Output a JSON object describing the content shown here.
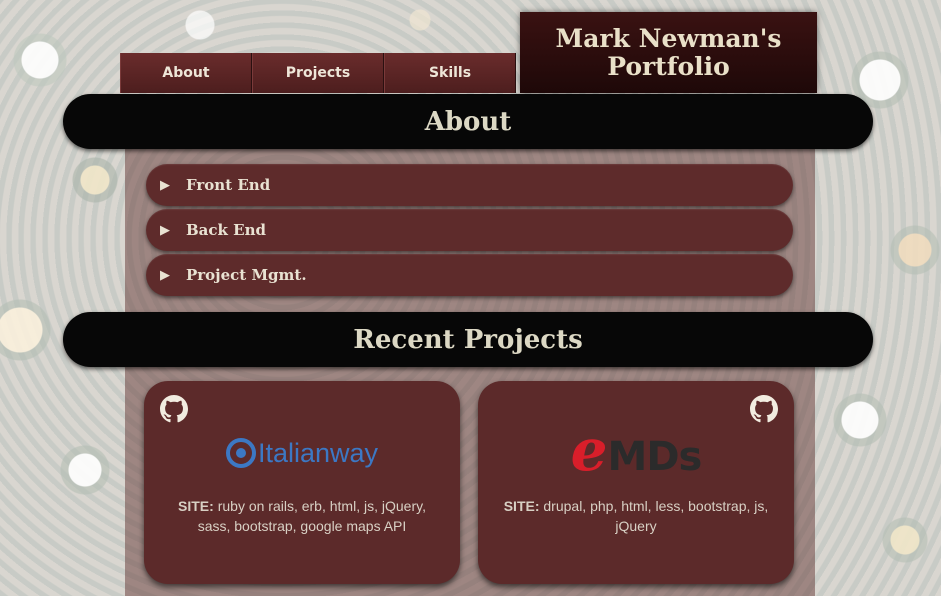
{
  "nav": {
    "tabs": [
      {
        "label": "About"
      },
      {
        "label": "Projects"
      },
      {
        "label": "Skills"
      }
    ]
  },
  "header": {
    "title": "Mark Newman's Portfolio"
  },
  "about": {
    "heading": "About",
    "items": [
      {
        "label": "Front End",
        "icon": "play-triangle-icon"
      },
      {
        "label": "Back End",
        "icon": "play-triangle-icon"
      },
      {
        "label": "Project Mgmt.",
        "icon": "play-triangle-icon"
      }
    ]
  },
  "projects": {
    "heading": "Recent Projects",
    "cards": [
      {
        "logo_text": "Italianway",
        "site_label": "SITE:",
        "site_tech": "ruby on rails, erb, html, js, jQuery, sass, bootstrap, google maps API",
        "icon": "github-icon"
      },
      {
        "logo_text_e": "e",
        "logo_text_rest": "MDs",
        "site_label": "SITE:",
        "site_tech": "drupal, php, html, less, bootstrap, js, jQuery",
        "icon": "github-icon"
      }
    ]
  },
  "colors": {
    "tab_bg": "#5a2525",
    "card_bg": "#5c2a2a",
    "header_bg": "#070707",
    "text_light": "#dcd8c4",
    "italianway_blue": "#3c78c4",
    "emds_red": "#d91e2a"
  }
}
